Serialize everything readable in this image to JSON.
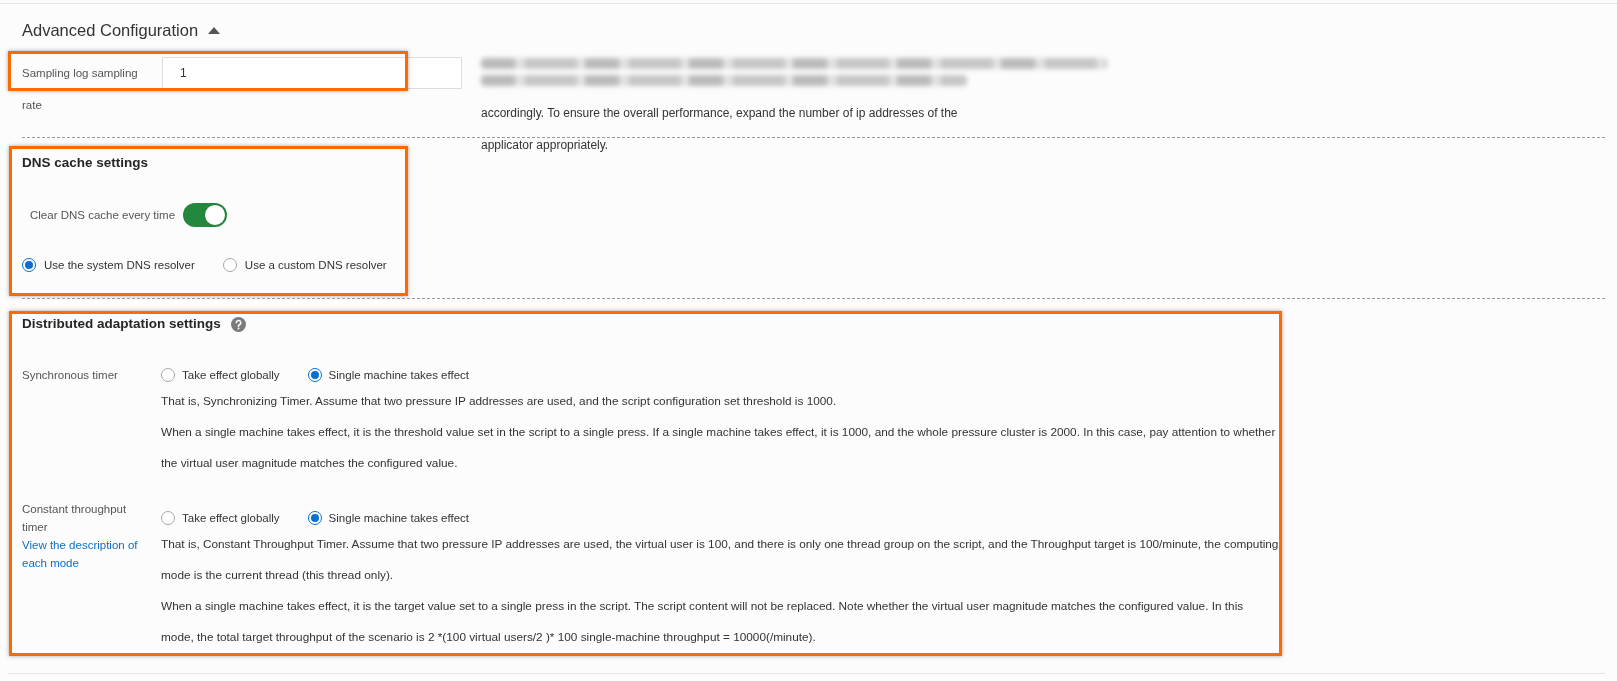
{
  "advanced": {
    "title": "Advanced Configuration",
    "expanded": true
  },
  "sampling": {
    "highlighted": true,
    "label": "Sampling log sampling rate",
    "value": "1",
    "help": "accordingly. To ensure the overall performance, expand the number of ip addresses of the applicator appropriately."
  },
  "dns_cache": {
    "highlighted": true,
    "title": "DNS cache settings",
    "clear_cache": {
      "label": "Clear DNS cache every time",
      "on": true
    },
    "resolvers": [
      {
        "label": "Use the system DNS resolver",
        "selected": true
      },
      {
        "label": "Use a custom DNS resolver",
        "selected": false
      }
    ]
  },
  "distributed": {
    "highlighted": true,
    "title": "Distributed adaptation settings",
    "timers": [
      {
        "label": "Synchronous timer",
        "options": [
          {
            "label": "Take effect globally",
            "selected": false
          },
          {
            "label": "Single machine takes effect",
            "selected": true
          }
        ],
        "descriptions": [
          "That is, Synchronizing Timer. Assume that two pressure IP addresses are used, and the script configuration set threshold is 1000.",
          "When a single machine takes effect, it is the threshold value set in the script to a single press. If a single machine takes effect, it is 1000, and the whole pressure cluster is 2000. In this case, pay attention to whether the virtual user magnitude matches the configured value."
        ]
      },
      {
        "label": "Constant throughput timer",
        "link": "View the description of each mode",
        "options": [
          {
            "label": "Take effect globally",
            "selected": false
          },
          {
            "label": "Single machine takes effect",
            "selected": true
          }
        ],
        "descriptions": [
          "That is, Constant Throughput Timer. Assume that two pressure IP addresses are used, the virtual user is 100, and there is only one thread group on the script, and the Throughput target is 100/minute, the computing mode is the current thread (this thread only).",
          "When a single machine takes effect, it is the target value set to a single press in the script. The script content will not be replaced. Note whether the virtual user magnitude matches the configured value. In this mode, the total target throughput of the scenario is 2 *(100 virtual users/2 )* 100 single-machine throughput = 10000(/minute)."
        ]
      }
    ]
  }
}
